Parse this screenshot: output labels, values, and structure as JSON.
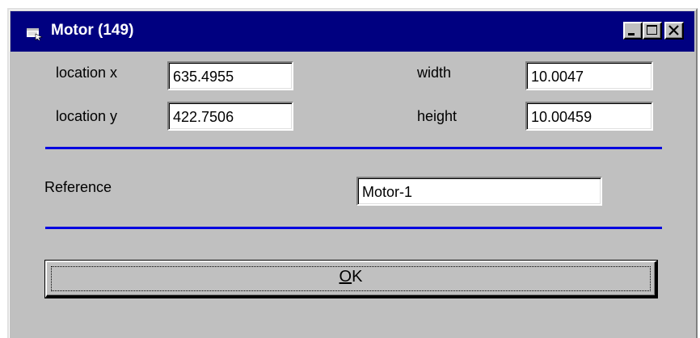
{
  "window": {
    "title": "Motor (149)",
    "app_icon": "app-window-icon",
    "controls": {
      "minimize_icon": "minimize-icon",
      "maximize_icon": "maximize-icon",
      "close_icon": "close-icon"
    },
    "title_bar_color": "#000080"
  },
  "form": {
    "location_x": {
      "label": "location x",
      "value": "635.4955"
    },
    "location_y": {
      "label": "location y",
      "value": "422.7506"
    },
    "width": {
      "label": "width",
      "value": "10.0047"
    },
    "height": {
      "label": "height",
      "value": "10.00459"
    },
    "reference": {
      "label": "Reference",
      "value": "Motor-1"
    }
  },
  "divider_color": "#0000e0",
  "ok_button": {
    "label": "OK",
    "mnemonic": "O",
    "rest": "K"
  }
}
